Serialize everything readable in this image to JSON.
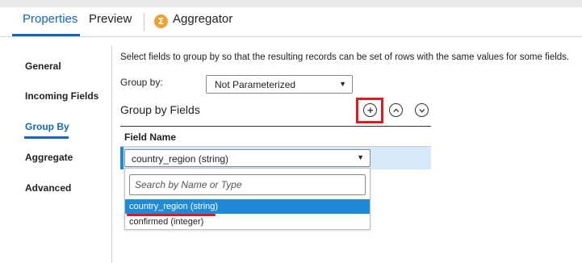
{
  "tabs": [
    {
      "label": "Properties"
    },
    {
      "label": "Preview"
    }
  ],
  "transformation": {
    "icon": "sigma-icon",
    "icon_glyph": "Σ",
    "label": "Aggregator"
  },
  "nav": {
    "items": [
      {
        "label": "General"
      },
      {
        "label": "Incoming Fields"
      },
      {
        "label": "Group By"
      },
      {
        "label": "Aggregate"
      },
      {
        "label": "Advanced"
      }
    ],
    "active": "Group By"
  },
  "main": {
    "description": "Select fields to group by so that the resulting records can be set of rows with the same values for some fields.",
    "group_by_label": "Group by:",
    "group_by_value": "Not Parameterized",
    "section_title": "Group by Fields",
    "column_header": "Field Name",
    "row_field_value": "country_region (string)",
    "dropdown": {
      "search_placeholder": "Search by Name or Type",
      "options": [
        "country_region (string)",
        "confirmed (integer)"
      ],
      "highlighted": "country_region (string)"
    }
  },
  "colors": {
    "accent": "#1466b8",
    "highlight": "#e0191b",
    "selected_row": "#d6e9f8",
    "option_highlight": "#1f8ad8"
  }
}
